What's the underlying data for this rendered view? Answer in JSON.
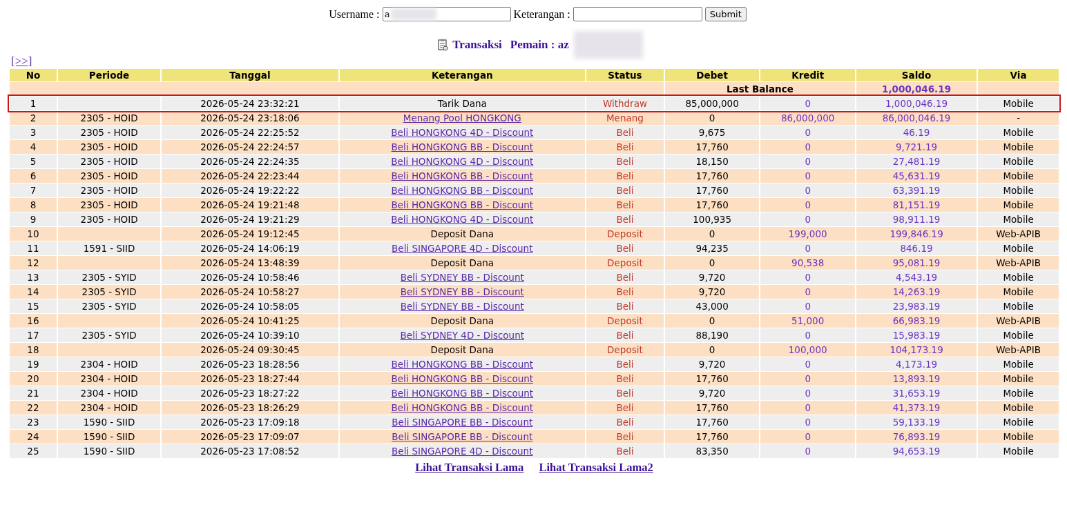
{
  "form": {
    "username_label": "Username :",
    "username_value": "a",
    "keterangan_label": "Keterangan :",
    "submit": "Submit"
  },
  "heading": {
    "title": "Transaksi",
    "player": "Pemain : az"
  },
  "nav_link": "[>>]",
  "table": {
    "columns": [
      "No",
      "Periode",
      "Tanggal",
      "Keterangan",
      "Status",
      "Debet",
      "Kredit",
      "Saldo",
      "Via"
    ],
    "last_balance": {
      "label": "Last Balance",
      "value": "1,000,046.19"
    },
    "rows": [
      {
        "no": "1",
        "periode": "",
        "tanggal": "2026-05-24 23:32:21",
        "keterangan": "Tarik Dana",
        "kind": "text",
        "status": "Withdraw",
        "debet": "85,000,000",
        "kredit": "0",
        "saldo": "1,000,046.19",
        "via": "Mobile",
        "highlighted": true
      },
      {
        "no": "2",
        "periode": "2305 - HOID",
        "tanggal": "2026-05-24 23:18:06",
        "keterangan": "Menang Pool HONGKONG",
        "kind": "link",
        "status": "Menang",
        "debet": "0",
        "kredit": "86,000,000",
        "saldo": "86,000,046.19",
        "via": "-",
        "highlighted": false
      },
      {
        "no": "3",
        "periode": "2305 - HOID",
        "tanggal": "2026-05-24 22:25:52",
        "keterangan": "Beli HONGKONG 4D - Discount",
        "kind": "link",
        "status": "Beli",
        "debet": "9,675",
        "kredit": "0",
        "saldo": "46.19",
        "via": "Mobile",
        "highlighted": false
      },
      {
        "no": "4",
        "periode": "2305 - HOID",
        "tanggal": "2026-05-24 22:24:57",
        "keterangan": "Beli HONGKONG BB - Discount",
        "kind": "link",
        "status": "Beli",
        "debet": "17,760",
        "kredit": "0",
        "saldo": "9,721.19",
        "via": "Mobile",
        "highlighted": false
      },
      {
        "no": "5",
        "periode": "2305 - HOID",
        "tanggal": "2026-05-24 22:24:35",
        "keterangan": "Beli HONGKONG 4D - Discount",
        "kind": "link",
        "status": "Beli",
        "debet": "18,150",
        "kredit": "0",
        "saldo": "27,481.19",
        "via": "Mobile",
        "highlighted": false
      },
      {
        "no": "6",
        "periode": "2305 - HOID",
        "tanggal": "2026-05-24 22:23:44",
        "keterangan": "Beli HONGKONG BB - Discount",
        "kind": "link",
        "status": "Beli",
        "debet": "17,760",
        "kredit": "0",
        "saldo": "45,631.19",
        "via": "Mobile",
        "highlighted": false
      },
      {
        "no": "7",
        "periode": "2305 - HOID",
        "tanggal": "2026-05-24 19:22:22",
        "keterangan": "Beli HONGKONG BB - Discount",
        "kind": "link",
        "status": "Beli",
        "debet": "17,760",
        "kredit": "0",
        "saldo": "63,391.19",
        "via": "Mobile",
        "highlighted": false
      },
      {
        "no": "8",
        "periode": "2305 - HOID",
        "tanggal": "2026-05-24 19:21:48",
        "keterangan": "Beli HONGKONG BB - Discount",
        "kind": "link",
        "status": "Beli",
        "debet": "17,760",
        "kredit": "0",
        "saldo": "81,151.19",
        "via": "Mobile",
        "highlighted": false
      },
      {
        "no": "9",
        "periode": "2305 - HOID",
        "tanggal": "2026-05-24 19:21:29",
        "keterangan": "Beli HONGKONG 4D - Discount",
        "kind": "link",
        "status": "Beli",
        "debet": "100,935",
        "kredit": "0",
        "saldo": "98,911.19",
        "via": "Mobile",
        "highlighted": false
      },
      {
        "no": "10",
        "periode": "",
        "tanggal": "2026-05-24 19:12:45",
        "keterangan": "Deposit Dana",
        "kind": "text",
        "status": "Deposit",
        "debet": "0",
        "kredit": "199,000",
        "saldo": "199,846.19",
        "via": "Web-APIB",
        "highlighted": false
      },
      {
        "no": "11",
        "periode": "1591 - SIID",
        "tanggal": "2026-05-24 14:06:19",
        "keterangan": "Beli SINGAPORE 4D - Discount",
        "kind": "link",
        "status": "Beli",
        "debet": "94,235",
        "kredit": "0",
        "saldo": "846.19",
        "via": "Mobile",
        "highlighted": false
      },
      {
        "no": "12",
        "periode": "",
        "tanggal": "2026-05-24 13:48:39",
        "keterangan": "Deposit Dana",
        "kind": "text",
        "status": "Deposit",
        "debet": "0",
        "kredit": "90,538",
        "saldo": "95,081.19",
        "via": "Web-APIB",
        "highlighted": false
      },
      {
        "no": "13",
        "periode": "2305 - SYID",
        "tanggal": "2026-05-24 10:58:46",
        "keterangan": "Beli SYDNEY BB - Discount",
        "kind": "link",
        "status": "Beli",
        "debet": "9,720",
        "kredit": "0",
        "saldo": "4,543.19",
        "via": "Mobile",
        "highlighted": false
      },
      {
        "no": "14",
        "periode": "2305 - SYID",
        "tanggal": "2026-05-24 10:58:27",
        "keterangan": "Beli SYDNEY BB - Discount",
        "kind": "link",
        "status": "Beli",
        "debet": "9,720",
        "kredit": "0",
        "saldo": "14,263.19",
        "via": "Mobile",
        "highlighted": false
      },
      {
        "no": "15",
        "periode": "2305 - SYID",
        "tanggal": "2026-05-24 10:58:05",
        "keterangan": "Beli SYDNEY BB - Discount",
        "kind": "link",
        "status": "Beli",
        "debet": "43,000",
        "kredit": "0",
        "saldo": "23,983.19",
        "via": "Mobile",
        "highlighted": false
      },
      {
        "no": "16",
        "periode": "",
        "tanggal": "2026-05-24 10:41:25",
        "keterangan": "Deposit Dana",
        "kind": "text",
        "status": "Deposit",
        "debet": "0",
        "kredit": "51,000",
        "saldo": "66,983.19",
        "via": "Web-APIB",
        "highlighted": false
      },
      {
        "no": "17",
        "periode": "2305 - SYID",
        "tanggal": "2026-05-24 10:39:10",
        "keterangan": "Beli SYDNEY 4D - Discount",
        "kind": "link",
        "status": "Beli",
        "debet": "88,190",
        "kredit": "0",
        "saldo": "15,983.19",
        "via": "Mobile",
        "highlighted": false
      },
      {
        "no": "18",
        "periode": "",
        "tanggal": "2026-05-24 09:30:45",
        "keterangan": "Deposit Dana",
        "kind": "text",
        "status": "Deposit",
        "debet": "0",
        "kredit": "100,000",
        "saldo": "104,173.19",
        "via": "Web-APIB",
        "highlighted": false
      },
      {
        "no": "19",
        "periode": "2304 - HOID",
        "tanggal": "2026-05-23 18:28:56",
        "keterangan": "Beli HONGKONG BB - Discount",
        "kind": "link",
        "status": "Beli",
        "debet": "9,720",
        "kredit": "0",
        "saldo": "4,173.19",
        "via": "Mobile",
        "highlighted": false
      },
      {
        "no": "20",
        "periode": "2304 - HOID",
        "tanggal": "2026-05-23 18:27:44",
        "keterangan": "Beli HONGKONG BB - Discount",
        "kind": "link",
        "status": "Beli",
        "debet": "17,760",
        "kredit": "0",
        "saldo": "13,893.19",
        "via": "Mobile",
        "highlighted": false
      },
      {
        "no": "21",
        "periode": "2304 - HOID",
        "tanggal": "2026-05-23 18:27:22",
        "keterangan": "Beli HONGKONG BB - Discount",
        "kind": "link",
        "status": "Beli",
        "debet": "9,720",
        "kredit": "0",
        "saldo": "31,653.19",
        "via": "Mobile",
        "highlighted": false
      },
      {
        "no": "22",
        "periode": "2304 - HOID",
        "tanggal": "2026-05-23 18:26:29",
        "keterangan": "Beli HONGKONG BB - Discount",
        "kind": "link",
        "status": "Beli",
        "debet": "17,760",
        "kredit": "0",
        "saldo": "41,373.19",
        "via": "Mobile",
        "highlighted": false
      },
      {
        "no": "23",
        "periode": "1590 - SIID",
        "tanggal": "2026-05-23 17:09:18",
        "keterangan": "Beli SINGAPORE BB - Discount",
        "kind": "link",
        "status": "Beli",
        "debet": "17,760",
        "kredit": "0",
        "saldo": "59,133.19",
        "via": "Mobile",
        "highlighted": false
      },
      {
        "no": "24",
        "periode": "1590 - SIID",
        "tanggal": "2026-05-23 17:09:07",
        "keterangan": "Beli SINGAPORE BB - Discount",
        "kind": "link",
        "status": "Beli",
        "debet": "17,760",
        "kredit": "0",
        "saldo": "76,893.19",
        "via": "Mobile",
        "highlighted": false
      },
      {
        "no": "25",
        "periode": "1590 - SIID",
        "tanggal": "2026-05-23 17:08:52",
        "keterangan": "Beli SINGAPORE 4D - Discount",
        "kind": "link",
        "status": "Beli",
        "debet": "83,350",
        "kredit": "0",
        "saldo": "94,653.19",
        "via": "Mobile",
        "highlighted": false
      }
    ]
  },
  "footer_links": [
    "Lihat Transaksi Lama",
    "Lihat Transaksi Lama2"
  ]
}
